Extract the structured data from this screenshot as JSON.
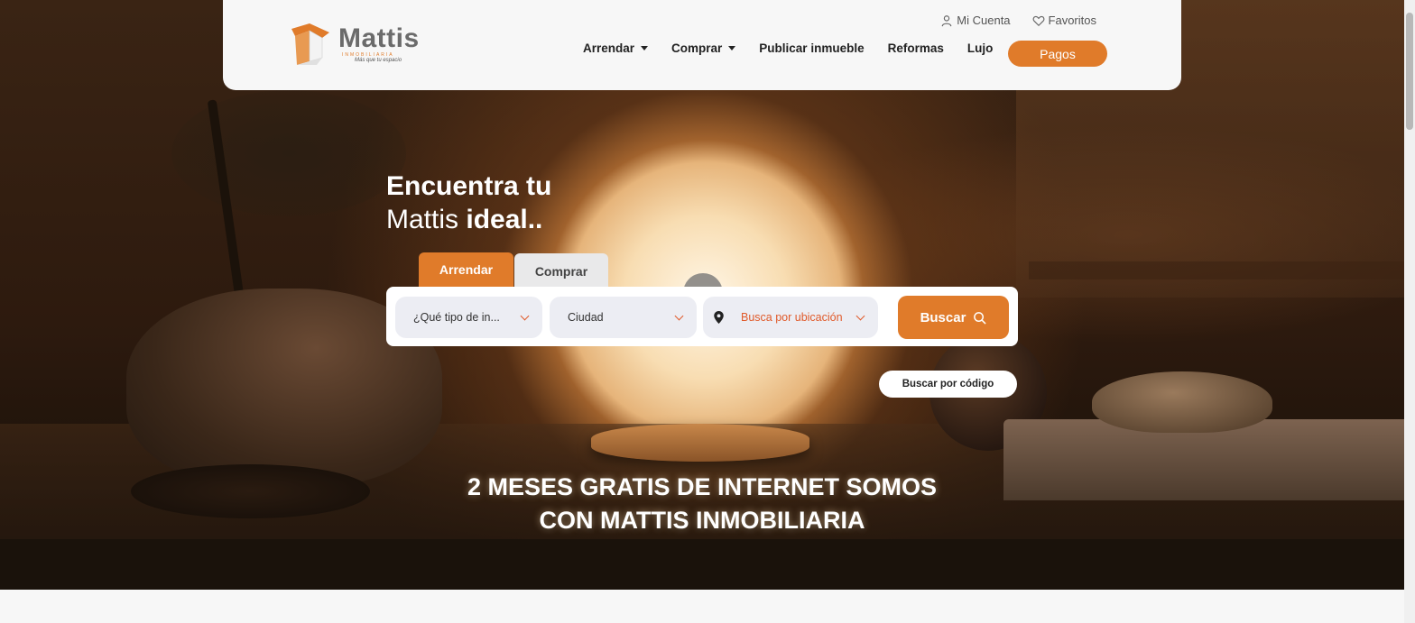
{
  "brand": {
    "name": "Mattis",
    "subtitle": "INMOBILIARIA",
    "tagline": "Más que tu espacio",
    "accent": "#e07b2a",
    "logo_gray": "#6b6b6b"
  },
  "top_links": {
    "account": "Mi Cuenta",
    "favorites": "Favoritos"
  },
  "nav": {
    "items": [
      "Arrendar",
      "Comprar",
      "Publicar inmueble",
      "Reformas",
      "Lujo"
    ],
    "pagos": "Pagos"
  },
  "headline": {
    "line1": "Encuentra tu",
    "line2_prefix": "Mattis ",
    "line2_bold": "ideal.."
  },
  "tabs": {
    "arrendar": "Arrendar",
    "comprar": "Comprar",
    "active": "Arrendar"
  },
  "search": {
    "tipo": "¿Qué tipo de in...",
    "ciudad": "Ciudad",
    "ubicacion": "Busca por ubicación",
    "buscar": "Buscar",
    "codigo": "Buscar por código"
  },
  "promo": {
    "line1": "2 MESES GRATIS DE INTERNET SOMOS",
    "line2": "CON MATTIS INMOBILIARIA"
  }
}
